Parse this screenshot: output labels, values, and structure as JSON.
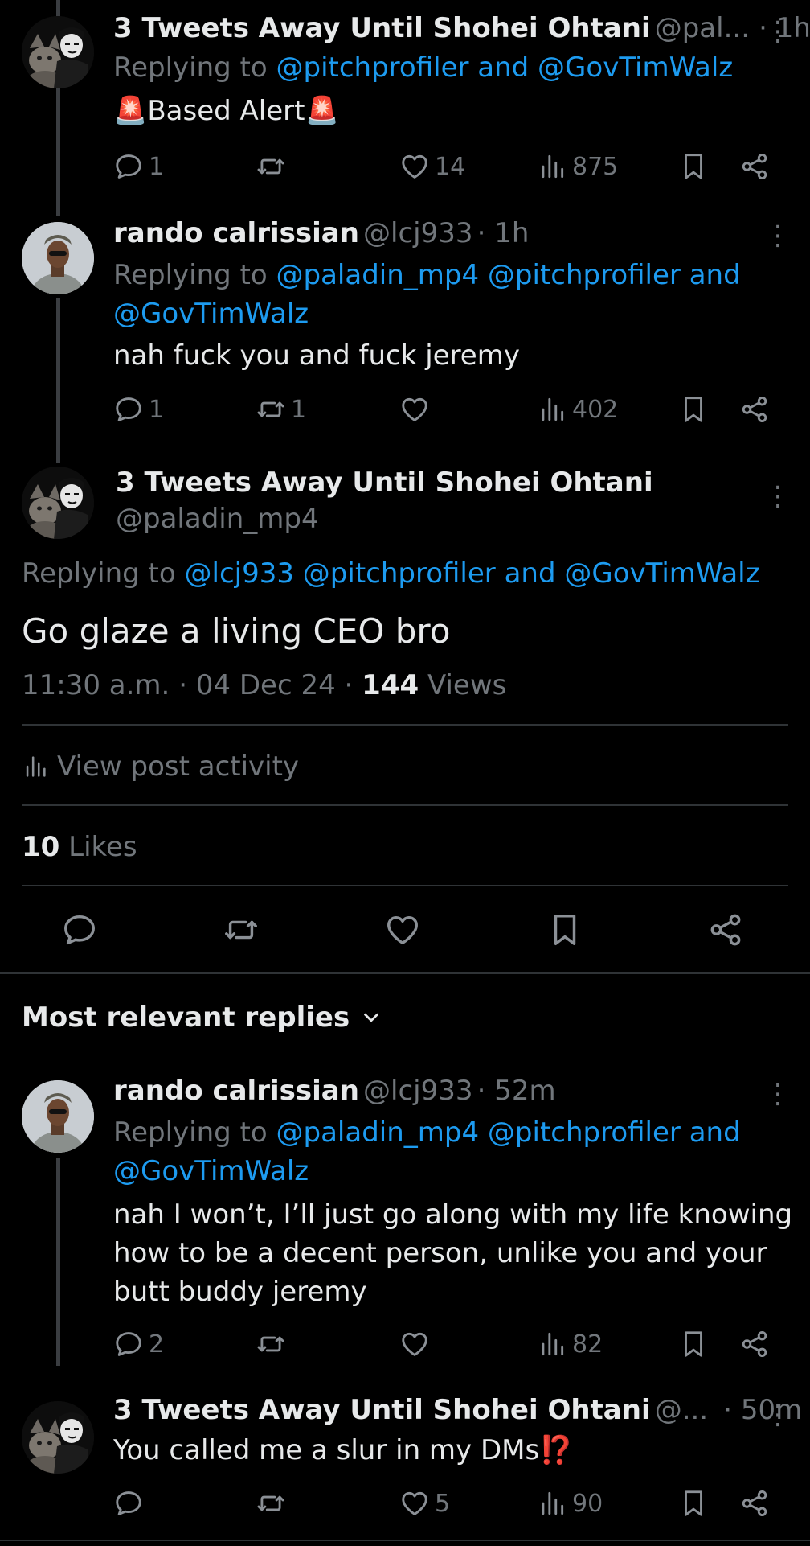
{
  "reply1": {
    "name": "3 Tweets Away Until Shohei Ohtani",
    "handle": "@pal...",
    "time": "· 1h",
    "replying_prefix": "Replying to",
    "replying_to": "@pitchprofiler and @GovTimWalz",
    "body": "Based Alert",
    "emoji_left": "🚨",
    "emoji_right": "🚨",
    "replies": "1",
    "retweets": "",
    "likes": "14",
    "views": "875"
  },
  "reply2": {
    "name": "rando calrissian",
    "handle": "@lcj933",
    "time": "· 1h",
    "replying_prefix": "Replying to",
    "replying_line1": "@paladin_mp4 @pitchprofiler and",
    "replying_line2": "@GovTimWalz",
    "body": "nah fuck you and fuck jeremy",
    "replies": "1",
    "retweets": "1",
    "likes": "",
    "views": "402"
  },
  "main_post": {
    "name": "3 Tweets Away Until Shohei Ohtani",
    "handle": "@paladin_mp4",
    "replying_prefix": "Replying to",
    "replying_to": "@lcj933 @pitchprofiler and @GovTimWalz",
    "body": "Go glaze a living CEO bro",
    "time": "11:30 a.m.",
    "date": "· 04 Dec 24 ·",
    "views_count": "144",
    "views_label": "Views",
    "activity_label": "View post activity",
    "likes_count": "10",
    "likes_label": "Likes"
  },
  "replies_header": {
    "label": "Most relevant replies"
  },
  "reply3": {
    "name": "rando calrissian",
    "handle": "@lcj933",
    "time": "· 52m",
    "replying_prefix": "Replying to",
    "replying_line1": "@paladin_mp4 @pitchprofiler and",
    "replying_line2": "@GovTimWalz",
    "body_line1": "nah I won’t, I’ll just go along with my life knowing",
    "body_line2": "how to be a decent person, unlike you and your",
    "body_line3": "butt buddy jeremy",
    "replies": "2",
    "retweets": "",
    "likes": "",
    "views": "82"
  },
  "reply4": {
    "name": "3 Tweets Away Until Shohei Ohtani",
    "handle": "@...",
    "time": "· 50m",
    "body": "You called me a slur in my DMs",
    "emoji": "⁉️",
    "replies": "",
    "retweets": "",
    "likes": "5",
    "views": "90"
  },
  "icons": {
    "reply": "reply-icon",
    "retweet": "retweet-icon",
    "like": "heart-icon",
    "views": "views-icon",
    "bookmark": "bookmark-icon",
    "share": "share-icon",
    "more": "more-icon"
  },
  "colors": {
    "background": "#000000",
    "text": "#e7e9ea",
    "muted": "#71767b",
    "link": "#1d9bf0",
    "divider": "#2f3336"
  }
}
